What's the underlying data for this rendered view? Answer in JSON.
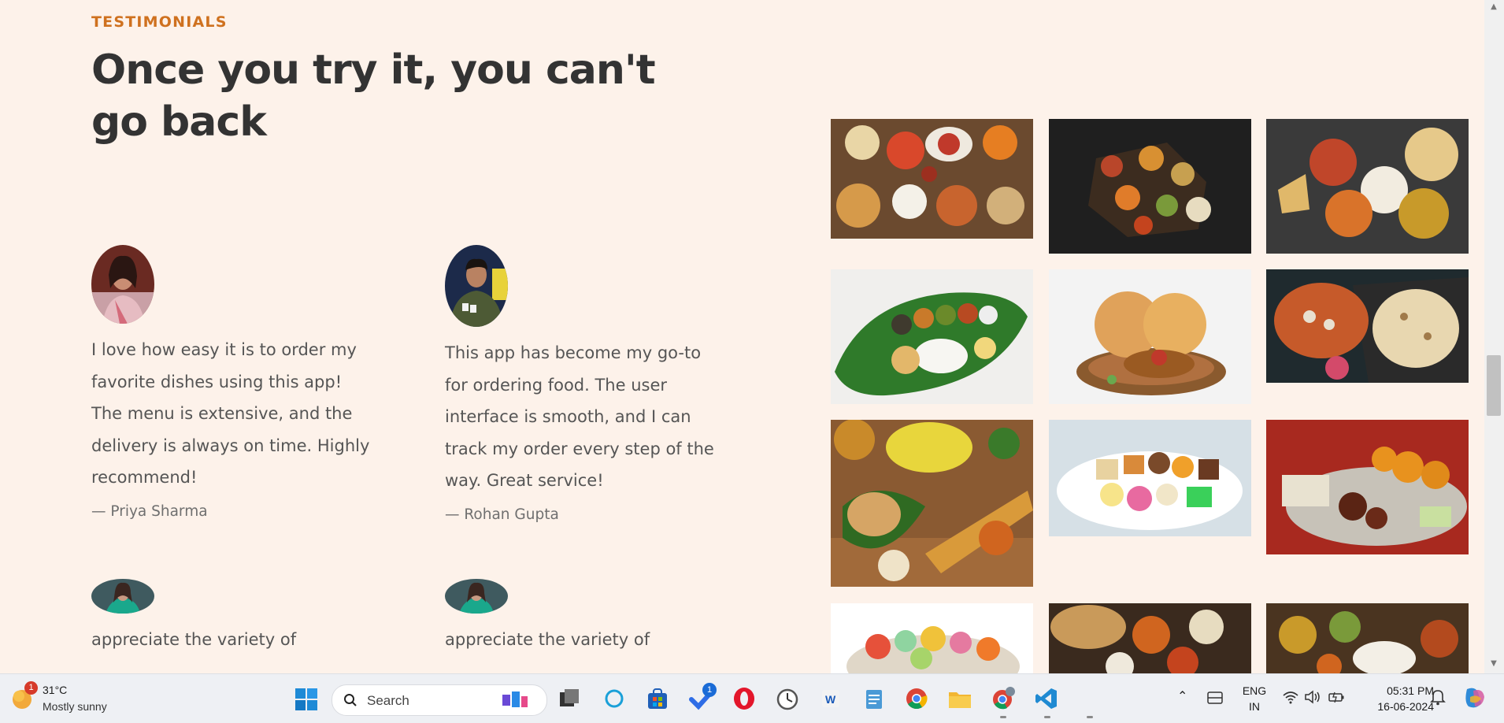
{
  "section": {
    "subheading": "TESTIMONIALS",
    "heading": "Once you try it, you can't go back"
  },
  "testimonials": [
    {
      "quote": "I love how easy it is to order my favorite dishes using this app! The menu is extensive, and the delivery is always on time. Highly recommend!",
      "author": "— Priya Sharma"
    },
    {
      "quote": "This app has become my go-to for ordering food. The user interface is smooth, and I can track my order every step of the way. Great service!",
      "author": "— Rohan Gupta"
    },
    {
      "quote": "appreciate the variety of",
      "author": ""
    },
    {
      "quote": "appreciate the variety of",
      "author": ""
    }
  ],
  "gallery": {
    "images": [
      "indian-food-spread-1",
      "dark-table-curries",
      "curry-bowls-paratha",
      "south-indian-banana-leaf-thali",
      "chole-bhature",
      "paneer-curry-naan",
      "dosa-idli-platter",
      "indian-sweets-plate",
      "gulab-jamun-sweets",
      "colorful-sweets-box",
      "naan-curries",
      "thali-rice-curries"
    ]
  },
  "taskbar": {
    "weather": {
      "temp": "31°C",
      "condition": "Mostly sunny",
      "badge": "1"
    },
    "search_placeholder": "Search",
    "todo_badge": "1",
    "language": {
      "line1": "ENG",
      "line2": "IN"
    },
    "clock": {
      "time": "05:31 PM",
      "date": "16-06-2024"
    },
    "icons": [
      "start-icon",
      "search-icon",
      "task-view-icon",
      "cortana-icon",
      "store-icon",
      "todo-icon",
      "opera-icon",
      "clock-app-icon",
      "word-icon",
      "notepad-icon",
      "chrome-icon",
      "file-explorer-icon",
      "chrome-profile-icon",
      "vscode-icon"
    ]
  },
  "colors": {
    "background": "#fdf2ea",
    "accent": "#cf711f",
    "heading": "#333333",
    "taskbar": "#eef0f4"
  }
}
